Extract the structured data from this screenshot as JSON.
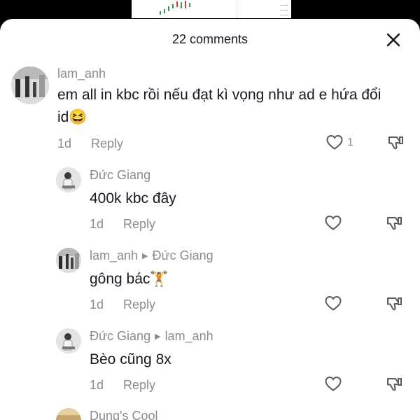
{
  "header": {
    "title": "22 comments"
  },
  "comments": [
    {
      "username": "lam_anh",
      "text_line1": "em all in kbc rồi nếu đạt kì vọng như ad e hứa đổi",
      "text_line2": "id😆",
      "time": "1d",
      "reply_label": "Reply",
      "likes": "1"
    },
    {
      "username": "Đức Giang",
      "text": "400k kbc đây",
      "time": "1d",
      "reply_label": "Reply"
    },
    {
      "username": "lam_anh",
      "reply_to": "Đức Giang",
      "text": "gông bác🏋️",
      "time": "1d",
      "reply_label": "Reply"
    },
    {
      "username": "Đức Giang",
      "reply_to": "lam_anh",
      "text": "Bèo cũng 8x",
      "time": "1d",
      "reply_label": "Reply"
    },
    {
      "username": "Dung's Cool"
    }
  ]
}
